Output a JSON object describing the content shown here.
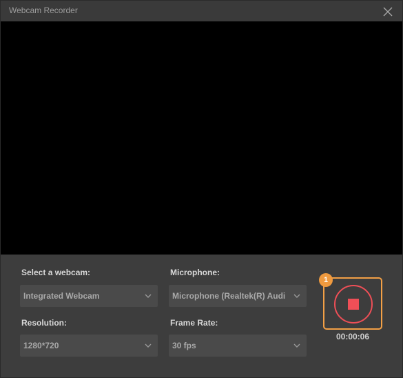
{
  "window": {
    "title": "Webcam Recorder",
    "close_icon": "close-icon"
  },
  "fields": {
    "webcam": {
      "label": "Select a webcam:",
      "value": "Integrated Webcam"
    },
    "microphone": {
      "label": "Microphone:",
      "value": "Microphone (Realtek(R) Audi"
    },
    "resolution": {
      "label": "Resolution:",
      "value": "1280*720"
    },
    "frame_rate": {
      "label": "Frame Rate:",
      "value": "30 fps"
    }
  },
  "recorder": {
    "badge": "1",
    "timer": "00:00:06",
    "stop_icon": "stop-record-icon"
  },
  "colors": {
    "highlight": "#f3a046",
    "record_accent": "#ef4f57",
    "preview_bg": "#000000"
  }
}
